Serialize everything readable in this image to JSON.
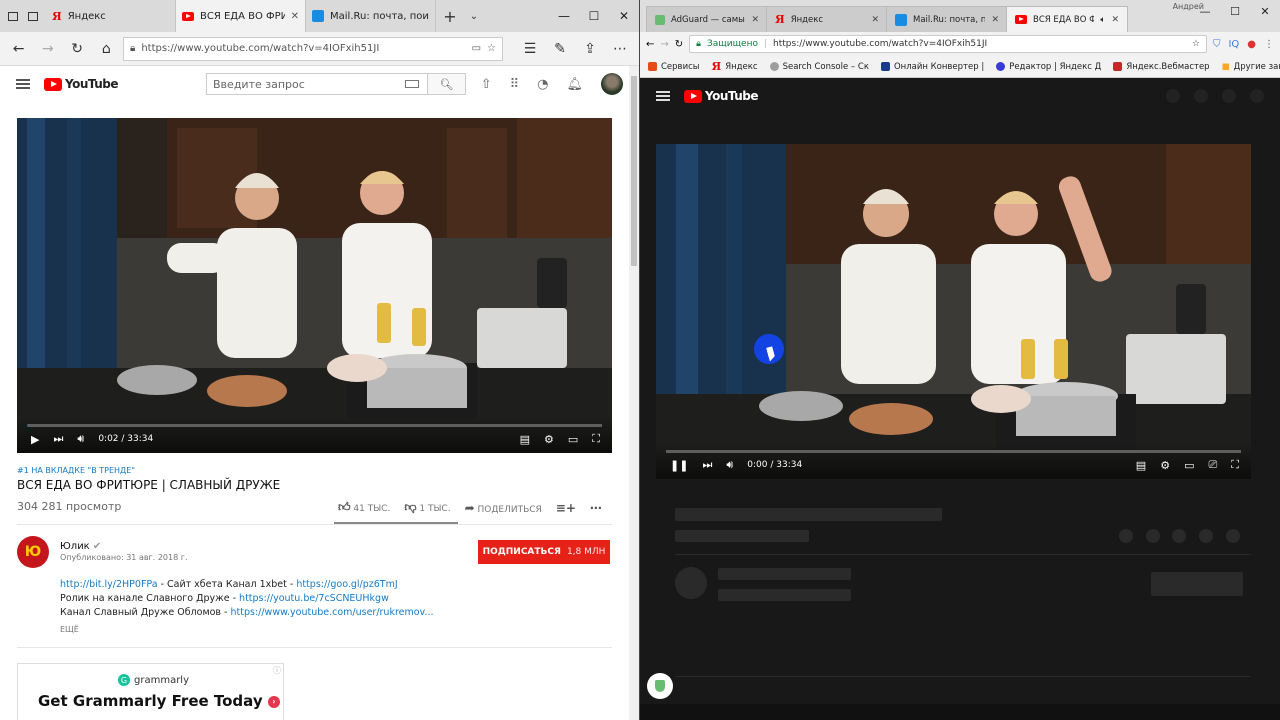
{
  "edge": {
    "tabs": [
      {
        "label": "Яндекс",
        "favicon": "yandex-icon"
      },
      {
        "label": "ВСЯ ЕДА ВО ФРИТЮРЕ",
        "favicon": "youtube-icon",
        "active": true
      },
      {
        "label": "Mail.Ru: почта, поиск в инт",
        "favicon": "mail-icon"
      }
    ],
    "url": "https://www.youtube.com/watch?v=4IOFxih51JI"
  },
  "yt_left": {
    "search_placeholder": "Введите запрос",
    "logo": "YouTube",
    "video": {
      "time": "0:02 / 33:34",
      "progress": 0.001
    },
    "trend_label": "#1 НА ВКЛАДКЕ \"В ТРЕНДЕ\"",
    "title": "ВСЯ ЕДА ВО ФРИТЮРЕ | СЛАВНЫЙ ДРУЖЕ",
    "views": "304 281 просмотр",
    "likes": "41 ТЫС.",
    "dislikes": "1 ТЫС.",
    "share": "ПОДЕЛИТЬСЯ",
    "channel": {
      "avatar_text": "Ю",
      "name": "Юлик",
      "published": "Опубликовано: 31 авг. 2018 г."
    },
    "subscribe": {
      "label": "ПОДПИСАТЬСЯ",
      "count": "1,8 МЛН"
    },
    "description": [
      {
        "link1": "http://bit.ly/2HP0FPa",
        "text": " - Сайт хбета Канал 1xbet - ",
        "link2": "https://goo.gl/pz6TmJ"
      },
      {
        "link1": "",
        "text": "Ролик на канале Славного Друже - ",
        "link2": "https://youtu.be/7cSCNEUHkgw"
      },
      {
        "link1": "",
        "text": "Канал Славный Друже Обломов - ",
        "link2": "https://www.youtube.com/user/rukremov..."
      }
    ],
    "more": "ЕЩЁ",
    "ad": {
      "brand": "grammarly",
      "headline": "Get Grammarly Free Today"
    }
  },
  "chrome": {
    "tabs": [
      {
        "label": "AdGuard — самый про",
        "favicon": "adguard-icon"
      },
      {
        "label": "Яндекс",
        "favicon": "yandex-icon"
      },
      {
        "label": "Mail.Ru: почта, поиск в",
        "favicon": "mail-icon"
      },
      {
        "label": "ВСЯ ЕДА ВО ФРИТЮ",
        "favicon": "youtube-icon",
        "active": true
      }
    ],
    "user": "Андрей",
    "secure_label": "Защищено",
    "url": "https://www.youtube.com/watch?v=4IOFxih51JI",
    "bookmarks": [
      {
        "label": "Сервисы",
        "color": "#e64a19"
      },
      {
        "label": "Яндекс",
        "color": "#e00000"
      },
      {
        "label": "Search Console – Ск",
        "color": "#9e9e9e"
      },
      {
        "label": "Онлайн Конвертер |",
        "color": "#1a3a8a"
      },
      {
        "label": "Редактор | Яндекс Д",
        "color": "#3a3ad8"
      },
      {
        "label": "Яндекс.Вебмастер",
        "color": "#c62828"
      }
    ],
    "other_bookmarks": "Другие закладки"
  },
  "yt_right": {
    "logo": "YouTube",
    "video": {
      "time": "0:00 / 33:34",
      "progress": 0.0
    }
  }
}
